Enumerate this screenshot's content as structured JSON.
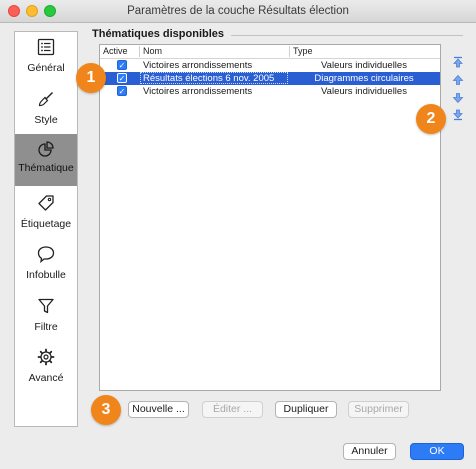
{
  "window": {
    "title": "Paramètres de la couche Résultats élection"
  },
  "sidebar": {
    "items": [
      {
        "label": "Général",
        "icon": "list-icon"
      },
      {
        "label": "Style",
        "icon": "brush-icon"
      },
      {
        "label": "Thématique",
        "icon": "thematic-chart-icon",
        "active": true
      },
      {
        "label": "Étiquetage",
        "icon": "tag-icon"
      },
      {
        "label": "Infobulle",
        "icon": "speech-bubble-icon"
      },
      {
        "label": "Filtre",
        "icon": "filter-icon"
      },
      {
        "label": "Avancé",
        "icon": "gear-icon"
      }
    ]
  },
  "section": {
    "title": "Thématiques disponibles"
  },
  "table": {
    "columns": [
      "Active",
      "Nom",
      "Type"
    ],
    "rows": [
      {
        "active": true,
        "name": "Victoires arrondissements",
        "type": "Valeurs individuelles",
        "selected": false
      },
      {
        "active": true,
        "name": "Résultats élections 6 nov. 2005",
        "type": "Diagrammes circulaires",
        "selected": true
      },
      {
        "active": true,
        "name": "Victoires arrondissements",
        "type": "Valeurs individuelles",
        "selected": false
      }
    ],
    "check_mark": "✓"
  },
  "order_buttons": [
    "move-to-top-icon",
    "move-up-icon",
    "move-down-icon",
    "move-to-bottom-icon"
  ],
  "actions": {
    "new": "Nouvelle ...",
    "edit": "Éditer ...",
    "duplicate": "Dupliquer",
    "delete": "Supprimer"
  },
  "dialog": {
    "cancel": "Annuler",
    "ok": "OK"
  },
  "callouts": [
    "1",
    "2",
    "3"
  ],
  "colors": {
    "selection": "#2a5fd4",
    "accent": "#2d7cf6",
    "callout": "#f0861b"
  }
}
